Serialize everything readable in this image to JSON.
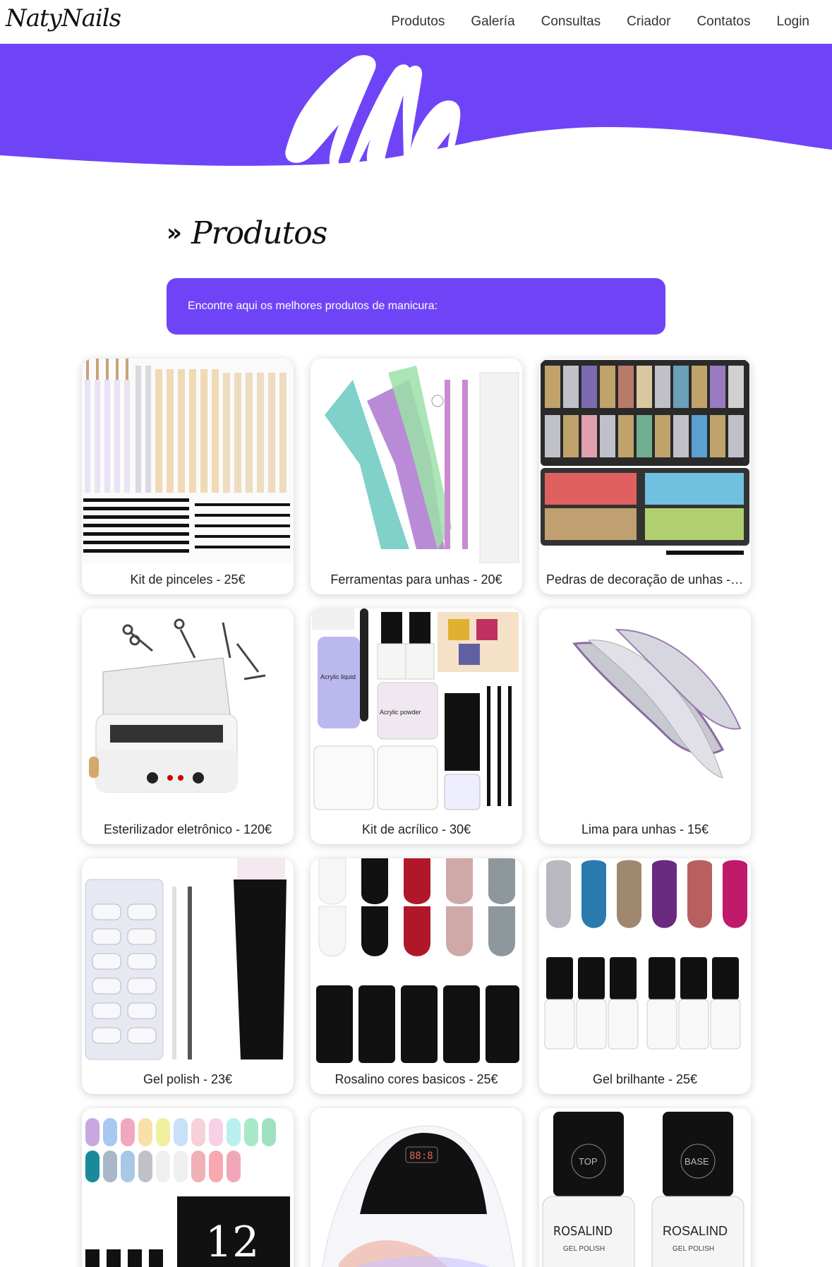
{
  "nav": {
    "logo": "NatyNails",
    "links": [
      "Produtos",
      "Galería",
      "Consultas",
      "Criador",
      "Contatos",
      "Login"
    ]
  },
  "hero": {
    "monogram": "NN",
    "color": "#6f44f7"
  },
  "section": {
    "title": "Produtos",
    "chevron": "»",
    "banner_text": "Encontre aqui os melhores produtos de manicura:"
  },
  "products": [
    {
      "label": "Kit de pinceles - 25€",
      "icon": "brushes-image"
    },
    {
      "label": "Ferramentas para unhas - 20€",
      "icon": "tools-image"
    },
    {
      "label": "Pedras de decoração de unhas - ...",
      "icon": "gems-image"
    },
    {
      "label": "Esterilizador eletrônico - 120€",
      "icon": "sterilizer-image"
    },
    {
      "label": "Kit de acrílico - 30€",
      "icon": "acrylic-kit-image"
    },
    {
      "label": "Lima para unhas - 15€",
      "icon": "nail-file-image"
    },
    {
      "label": "Gel polish - 23€",
      "icon": "gel-polish-image"
    },
    {
      "label": "Rosalino cores basicos - 25€",
      "icon": "basic-colors-image"
    },
    {
      "label": "Gel brilhante - 25€",
      "icon": "glitter-gel-image"
    },
    {
      "label": "",
      "icon": "pastel-colors-image"
    },
    {
      "label": "",
      "icon": "uv-lamp-image"
    },
    {
      "label": "",
      "icon": "top-base-image"
    }
  ],
  "images": {
    "top_label": "TOP",
    "base_label": "BASE",
    "brand": "ROSALIND",
    "sub": "GEL POLISH",
    "acrylic_liquid": "Acrylic liquid",
    "acrylic_powder": "Acrylic powder",
    "lamp_display": "88:8",
    "kit_number": "12"
  }
}
